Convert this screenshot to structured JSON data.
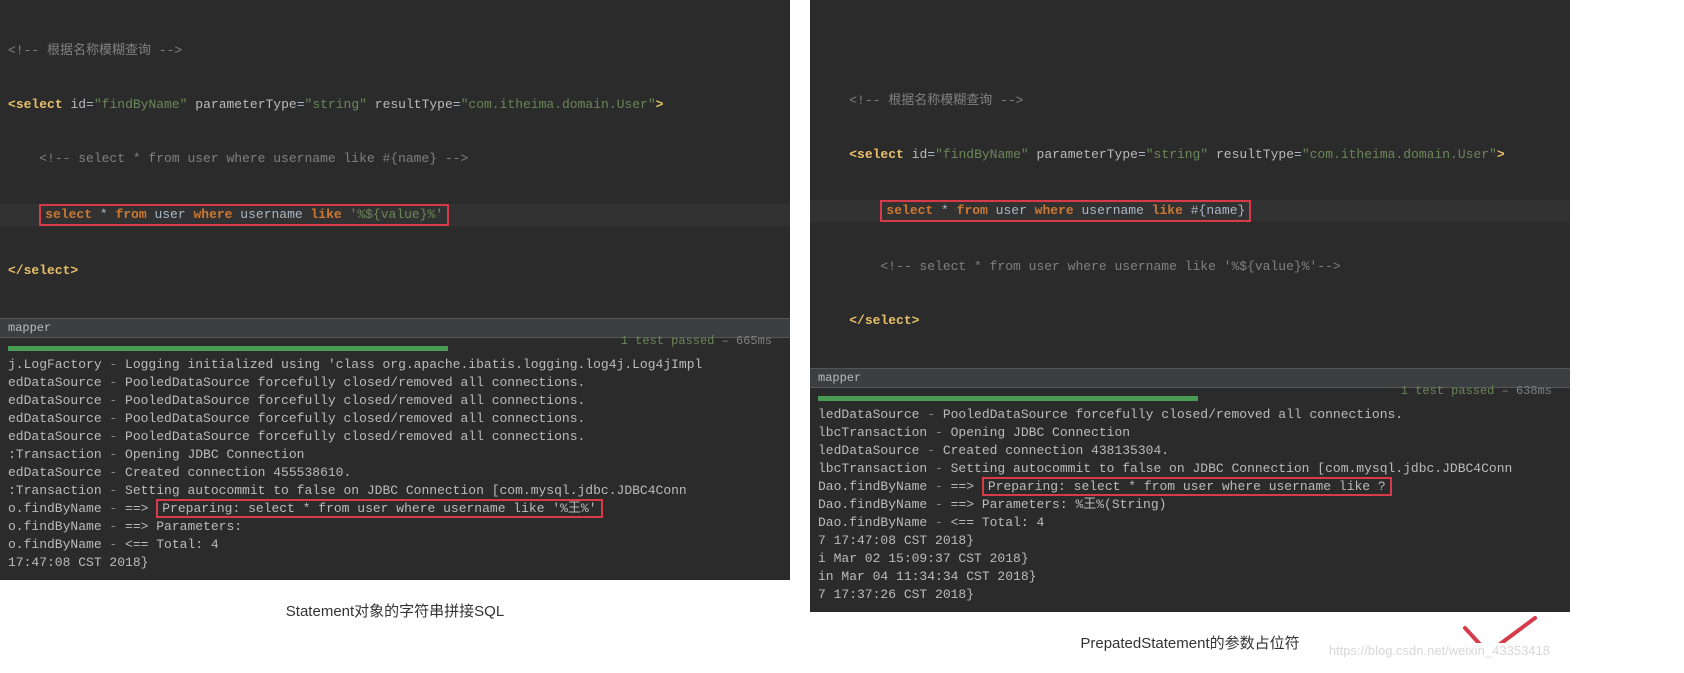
{
  "left": {
    "code": {
      "comment1": "<!-- 根据名称模糊查询 -->",
      "select_open_pre": "<",
      "select_tag": "select",
      "id_attr": "id",
      "id_val": "\"findByName\"",
      "pt_attr": "parameterType",
      "pt_val": "\"string\"",
      "rt_attr": "resultType",
      "rt_val": "\"com.itheima.domain.User\"",
      "close": ">",
      "inner_comment": "<!-- select * from user where username like #{name} -->",
      "sql_kw_select": "select",
      "sql_star": " * ",
      "sql_kw_from": "from",
      "sql_user": " user ",
      "sql_kw_where": "where",
      "sql_username": " username ",
      "sql_kw_like": "like",
      "sql_val": " '%${value}%'",
      "select_close": "</select>"
    },
    "breadcrumb": "mapper",
    "test": {
      "passed": "1 test passed",
      "time": " – 665ms"
    },
    "console": [
      {
        "src": "j.LogFactory",
        "msg": "Logging initialized using 'class org.apache.ibatis.logging.log4j.Log4jImpl"
      },
      {
        "src": "edDataSource",
        "msg": "PooledDataSource forcefully closed/removed all connections."
      },
      {
        "src": "edDataSource",
        "msg": "PooledDataSource forcefully closed/removed all connections."
      },
      {
        "src": "edDataSource",
        "msg": "PooledDataSource forcefully closed/removed all connections."
      },
      {
        "src": "edDataSource",
        "msg": "PooledDataSource forcefully closed/removed all connections."
      },
      {
        "src": ":Transaction",
        "msg": "Opening JDBC Connection"
      },
      {
        "src": "edDataSource",
        "msg": "Created connection 455538610."
      },
      {
        "src": ":Transaction",
        "msg": "Setting autocommit to false on JDBC Connection [com.mysql.jdbc.JDBC4Conn"
      },
      {
        "src": "o.findByName",
        "msg_pre": "==> ",
        "boxed": "Preparing: select * from user where username like '%王%'"
      },
      {
        "src": "o.findByName",
        "msg": "==> Parameters:"
      },
      {
        "src": "o.findByName",
        "msg": "<==      Total: 4"
      },
      {
        "src": "",
        "msg": "17:47:08 CST 2018}"
      }
    ],
    "caption": "Statement对象的字符串拼接SQL"
  },
  "right": {
    "code": {
      "comment1": "<!-- 根据名称模糊查询 -->",
      "select_tag": "select",
      "id_attr": "id",
      "id_val": "\"findByName\"",
      "pt_attr": "parameterType",
      "pt_val": "\"string\"",
      "rt_attr": "resultType",
      "rt_val": "\"com.itheima.domain.User\"",
      "close": ">",
      "sql_kw_select": "select",
      "sql_star": " * ",
      "sql_kw_from": "from",
      "sql_user": " user ",
      "sql_kw_where": "where",
      "sql_username": " username ",
      "sql_kw_like": "like",
      "sql_val": " #{name}",
      "inner_comment": "<!-- select * from user where username like '%${value}%'-->",
      "select_close": "</select>"
    },
    "breadcrumb": "mapper",
    "test": {
      "passed": "1 test passed",
      "time": " – 638ms"
    },
    "console": [
      {
        "src": "ledDataSource",
        "msg": "PooledDataSource forcefully closed/removed all connections."
      },
      {
        "src": "lbcTransaction",
        "msg": "Opening JDBC Connection"
      },
      {
        "src": "ledDataSource",
        "msg": "Created connection 438135304."
      },
      {
        "src": "lbcTransaction",
        "msg": "Setting autocommit to false on JDBC Connection [com.mysql.jdbc.JDBC4Conn"
      },
      {
        "src": "Dao.findByName",
        "msg_pre": "==> ",
        "boxed": "Preparing: select * from user where username like ?"
      },
      {
        "src": "Dao.findByName",
        "msg": "==> Parameters: %王%(String)"
      },
      {
        "src": "Dao.findByName",
        "msg": "<==      Total: 4"
      },
      {
        "src": "",
        "msg": "7 17:47:08 CST 2018}"
      },
      {
        "src": "",
        "msg": "i Mar 02 15:09:37 CST 2018}"
      },
      {
        "src": "",
        "msg": "in Mar 04 11:34:34 CST 2018}"
      },
      {
        "src": "",
        "msg": "7 17:37:26 CST 2018}"
      }
    ],
    "caption": "PrepatedStatement的参数占位符"
  },
  "watermark": "https://blog.csdn.net/weixin_43353418"
}
